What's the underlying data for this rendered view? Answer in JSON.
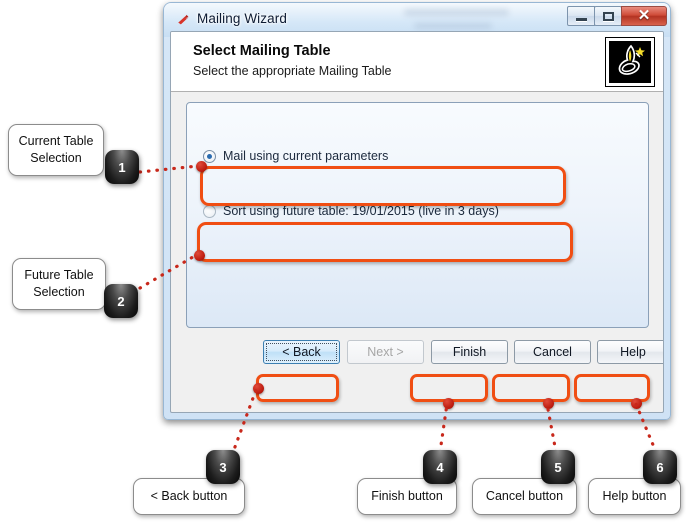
{
  "window": {
    "title": "Mailing Wizard",
    "title_icon": "red-arrow-icon",
    "controls": {
      "minimize": "minimize-icon",
      "maximize": "maximize-icon",
      "close": "✕"
    }
  },
  "wizard": {
    "heading": "Select Mailing Table",
    "subheading": "Select the appropriate Mailing Table",
    "logo": "genie-lamp-logo",
    "options": [
      {
        "label": "Mail using current parameters",
        "selected": true
      },
      {
        "label": "Sort using future table: 19/01/2015 (live in 3 days)",
        "selected": false
      }
    ]
  },
  "buttons": [
    {
      "label": "< Back",
      "state": "focused"
    },
    {
      "label": "Next >",
      "state": "disabled"
    },
    {
      "label": "Finish",
      "state": "normal"
    },
    {
      "label": "Cancel",
      "state": "normal"
    },
    {
      "label": "Help",
      "state": "normal"
    }
  ],
  "callouts": [
    {
      "number": "1",
      "label": "Current Table\nSelection"
    },
    {
      "number": "2",
      "label": "Future Table\nSelection"
    },
    {
      "number": "3",
      "label": "< Back button"
    },
    {
      "number": "4",
      "label": "Finish button"
    },
    {
      "number": "5",
      "label": "Cancel button"
    },
    {
      "number": "6",
      "label": "Help button"
    }
  ],
  "colors": {
    "highlight": "#f04e13",
    "anchor": "#bd1c10",
    "badge": "#1c1c1c",
    "close_button": "#cf4b38",
    "accent_blue": "#2b6cb0"
  }
}
